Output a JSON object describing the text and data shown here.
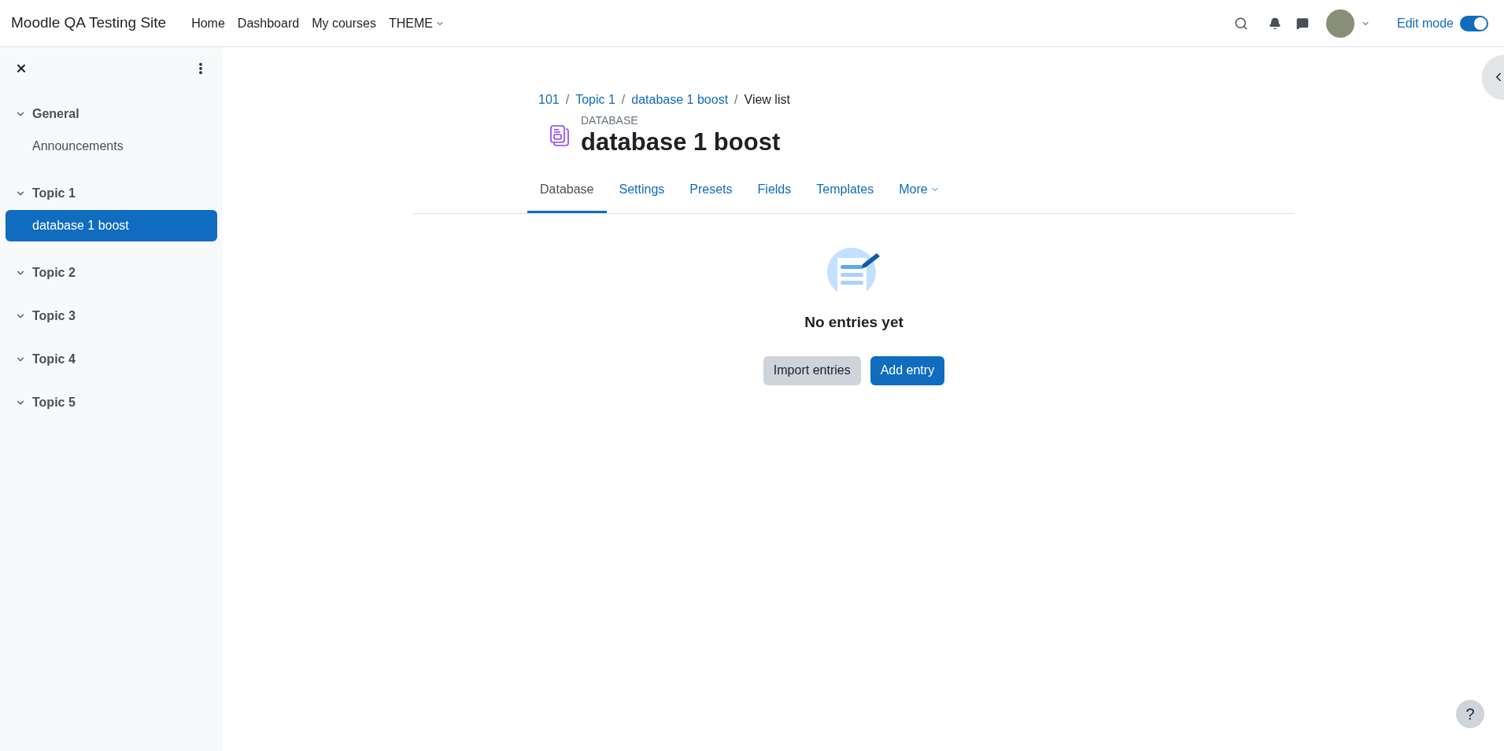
{
  "navbar": {
    "site_name": "Moodle QA Testing Site",
    "links": [
      {
        "label": "Home",
        "dropdown": false
      },
      {
        "label": "Dashboard",
        "dropdown": false
      },
      {
        "label": "My courses",
        "dropdown": false
      },
      {
        "label": "THEME",
        "dropdown": true
      }
    ],
    "edit_mode": {
      "label": "Edit mode",
      "on": true
    }
  },
  "sidebar": {
    "sections": [
      {
        "label": "General",
        "expanded": true,
        "children": [
          {
            "label": "Announcements",
            "selected": false
          }
        ]
      },
      {
        "label": "Topic 1",
        "expanded": true,
        "children": [
          {
            "label": "database 1 boost",
            "selected": true
          }
        ]
      },
      {
        "label": "Topic 2",
        "expanded": true
      },
      {
        "label": "Topic 3",
        "expanded": true
      },
      {
        "label": "Topic 4",
        "expanded": true
      },
      {
        "label": "Topic 5",
        "expanded": true
      }
    ]
  },
  "breadcrumb": {
    "separator": "/",
    "items": [
      "101",
      "Topic 1",
      "database 1 boost",
      "View list"
    ]
  },
  "header": {
    "kind_label": "DATABASE",
    "title": "database 1 boost"
  },
  "tabs": [
    {
      "label": "Database",
      "selected": true,
      "dropdown": false
    },
    {
      "label": "Settings",
      "selected": false,
      "dropdown": false
    },
    {
      "label": "Presets",
      "selected": false,
      "dropdown": false
    },
    {
      "label": "Fields",
      "selected": false,
      "dropdown": false
    },
    {
      "label": "Templates",
      "selected": false,
      "dropdown": false
    },
    {
      "label": "More",
      "selected": false,
      "dropdown": true
    }
  ],
  "empty_state": {
    "message": "No entries yet",
    "buttons": [
      {
        "label": "Import entries",
        "kind": "secondary"
      },
      {
        "label": "Add entry",
        "kind": "primary"
      }
    ]
  },
  "help_button": "?"
}
